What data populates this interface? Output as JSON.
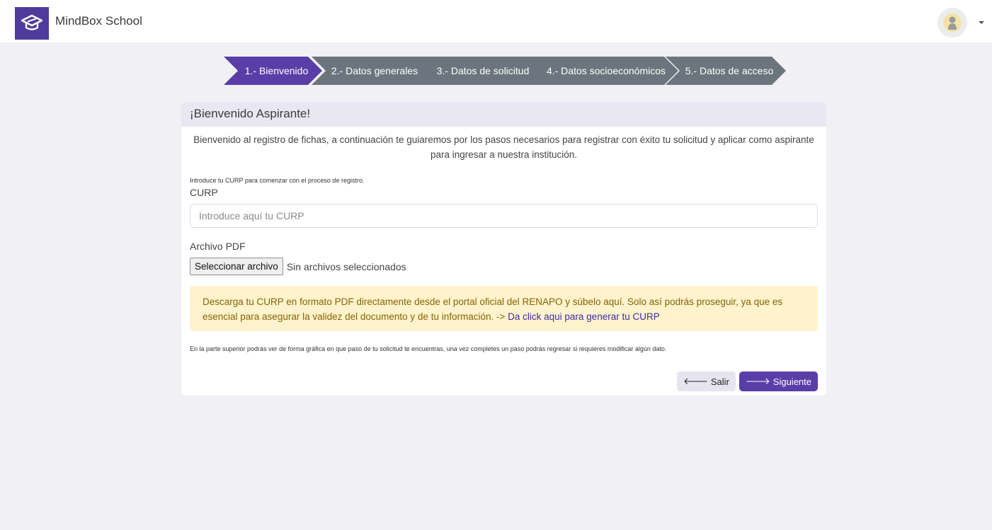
{
  "app": {
    "brand": "MindBox School"
  },
  "stepper": [
    {
      "label": "1.- Bienvenido",
      "active": true
    },
    {
      "label": "2.- Datos generales",
      "active": false
    },
    {
      "label": "3.- Datos de solicitud",
      "active": false
    },
    {
      "label": "4.- Datos socioeconómicos",
      "active": false
    },
    {
      "label": "5.- Datos de acceso",
      "active": false
    }
  ],
  "card": {
    "title": "¡Bienvenido Aspirante!",
    "intro_line1": "Bienvenido al registro de fichas, a continuación te guiaremos por los pasos necesarios para registrar con éxito tu solicitud y aplicar como aspirante",
    "intro_line2": "para ingresar a nuestra institución.",
    "curp_hint": "Introduce tu CURP para comenzar con el proceso de registro.",
    "curp_label": "CURP",
    "curp_placeholder": "Introduce aquí tu CURP",
    "curp_value": "",
    "pdf_label": "Archivo PDF",
    "file_button": "Seleccionar archivo",
    "file_status": "Sin archivos seleccionados",
    "alert_text": "Descarga tu CURP en formato PDF directamente desde el portal oficial del RENAPO y súbelo aquí. Solo así podrás proseguir, ya que es esencial para asegurar la validez del documento y de tu información. -> ",
    "alert_link": "Da click aqui para generar tu CURP",
    "footer_note": "En la parte superior podrás ver de forma gráfica en que paso de tu solicitud te encuentras, una vez completes un paso podrás regresar si requieres modificar algún dato.",
    "exit_button": "Salir",
    "next_button": "Siguiente"
  },
  "colors": {
    "brand": "#4f3b9b",
    "step_active": "#5a3ea8",
    "step_inactive": "#6c757d",
    "alert_bg": "#fff3cd",
    "alert_text": "#856404"
  },
  "icons": {
    "logo": "graduation-cap-icon",
    "avatar": "user-avatar-icon",
    "exit": "arrow-left-icon",
    "next": "arrow-right-icon"
  }
}
